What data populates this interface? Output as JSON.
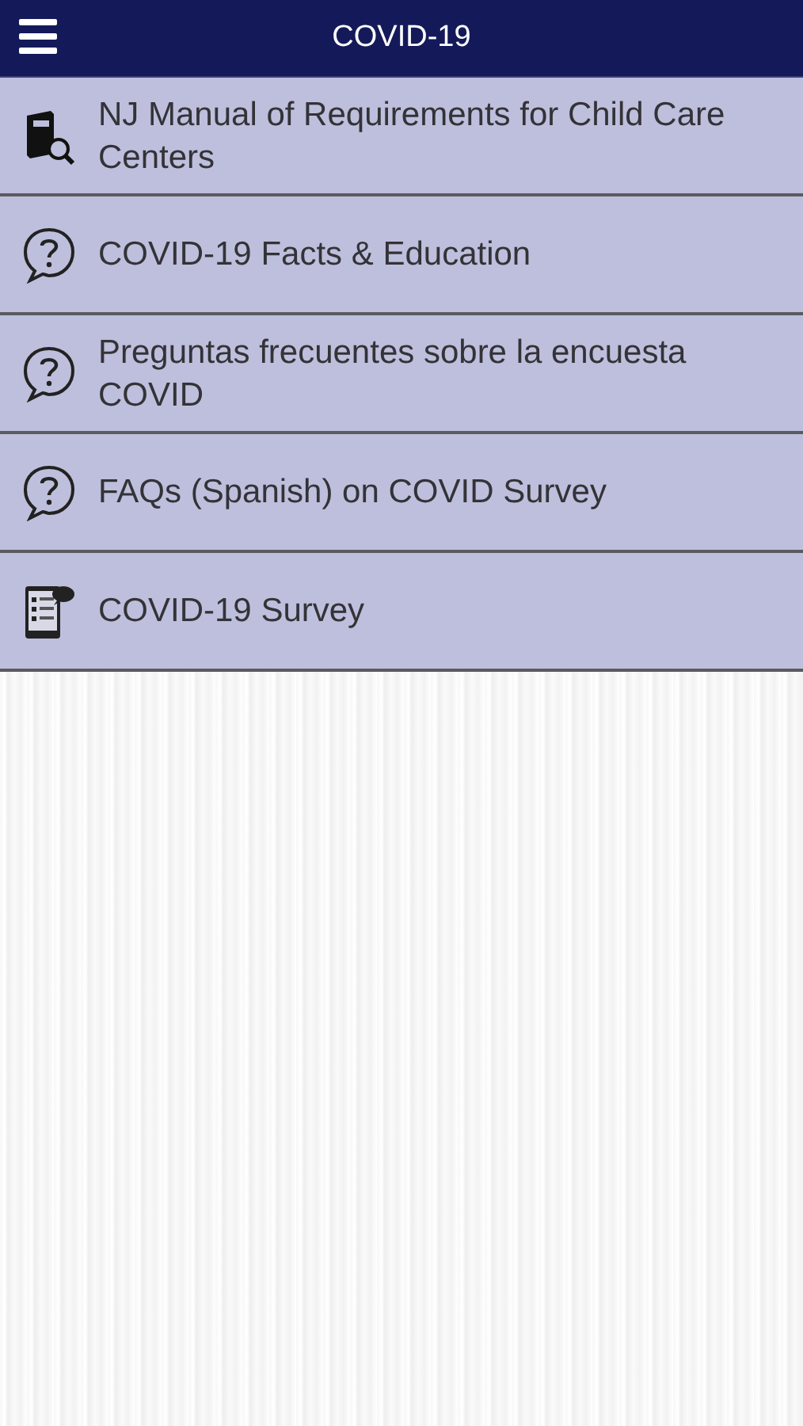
{
  "header": {
    "title": "COVID-19"
  },
  "items": [
    {
      "kind": "manual",
      "label": "NJ Manual of Requirements for Child Care Centers"
    },
    {
      "kind": "question",
      "label": "COVID-19 Facts & Education"
    },
    {
      "kind": "question",
      "label": "Preguntas frecuentes sobre la encuesta COVID"
    },
    {
      "kind": "question",
      "label": "FAQs (Spanish) on COVID Survey"
    },
    {
      "kind": "survey",
      "label": "COVID-19 Survey"
    }
  ]
}
